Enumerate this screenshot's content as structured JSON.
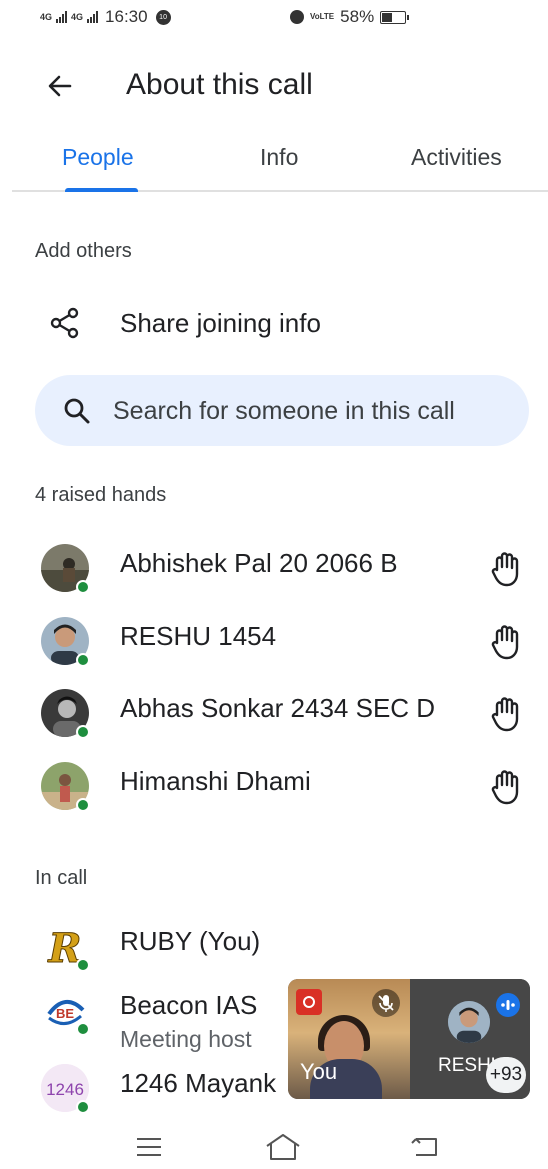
{
  "status_bar": {
    "signal_1": "4G",
    "signal_2": "4G",
    "time": "16:30",
    "notification_badge": "10",
    "volte": "VoLTE",
    "battery": "58%"
  },
  "header": {
    "title": "About this call",
    "back_icon": "arrow-left-icon"
  },
  "tabs": [
    {
      "label": "People",
      "active": true
    },
    {
      "label": "Info",
      "active": false
    },
    {
      "label": "Activities",
      "active": false
    }
  ],
  "add_others": {
    "section_label": "Add others",
    "share_label": "Share joining info"
  },
  "search": {
    "placeholder": "Search for someone in this call"
  },
  "raised_hands": {
    "section_label": "4 raised hands",
    "people": [
      {
        "name": "Abhishek Pal 20 2066 B"
      },
      {
        "name": "RESHU 1454"
      },
      {
        "name": "Abhas Sonkar 2434 SEC D"
      },
      {
        "name": "Himanshi Dhami"
      }
    ]
  },
  "in_call": {
    "section_label": "In call",
    "people": [
      {
        "name": "RUBY (You)"
      },
      {
        "name": "Beacon IAS",
        "role": "Meeting host",
        "avatar_text": "BE"
      },
      {
        "name": "1246 Mayank",
        "avatar_text": "1246"
      }
    ]
  },
  "pip": {
    "self_label": "You",
    "other_label": "RESHU",
    "more_count": "+93"
  },
  "colors": {
    "accent": "#1a73e8",
    "online": "#1e8e3e",
    "search_bg": "#e8f0fe",
    "recording": "#d93025"
  }
}
